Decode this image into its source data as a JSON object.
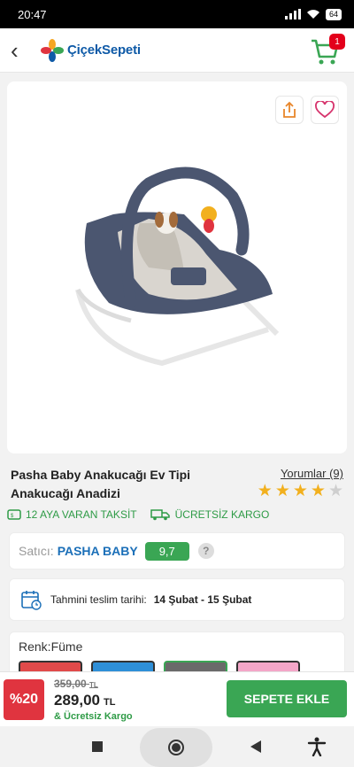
{
  "status_bar": {
    "time": "20:47",
    "battery": "64"
  },
  "header": {
    "logo_text": "ÇiçekSepeti",
    "cart_count": "1"
  },
  "product": {
    "title": "Pasha Baby Anakucağı Ev Tipi Anakucağı Anadizi",
    "reviews_label": "Yorumlar (9)",
    "rating": 4,
    "rating_max": 5
  },
  "badges": {
    "installment": "12 AYA VARAN TAKSİT",
    "free_shipping": "ÜCRETSİZ KARGO"
  },
  "seller": {
    "label": "Satıcı:",
    "name": "PASHA BABY",
    "score": "9,7",
    "help": "?"
  },
  "delivery": {
    "label": "Tahmini teslim tarihi:",
    "value": "14 Şubat - 15 Şubat"
  },
  "color": {
    "label": "Renk:Füme",
    "swatches": [
      "#e04a4a",
      "#2e8fd8",
      "#6a6a6a",
      "#f4a6c8"
    ]
  },
  "bottom": {
    "discount": "%20",
    "old_price": "359,00",
    "old_currency": "TL",
    "price": "289,00",
    "currency": "TL",
    "free_shipping": "& Ücretsiz Kargo",
    "add_to_cart": "SEPETE EKLE"
  },
  "colors": {
    "green": "#3aa654",
    "brand_blue": "#0e5aa7",
    "red": "#e0343f"
  }
}
